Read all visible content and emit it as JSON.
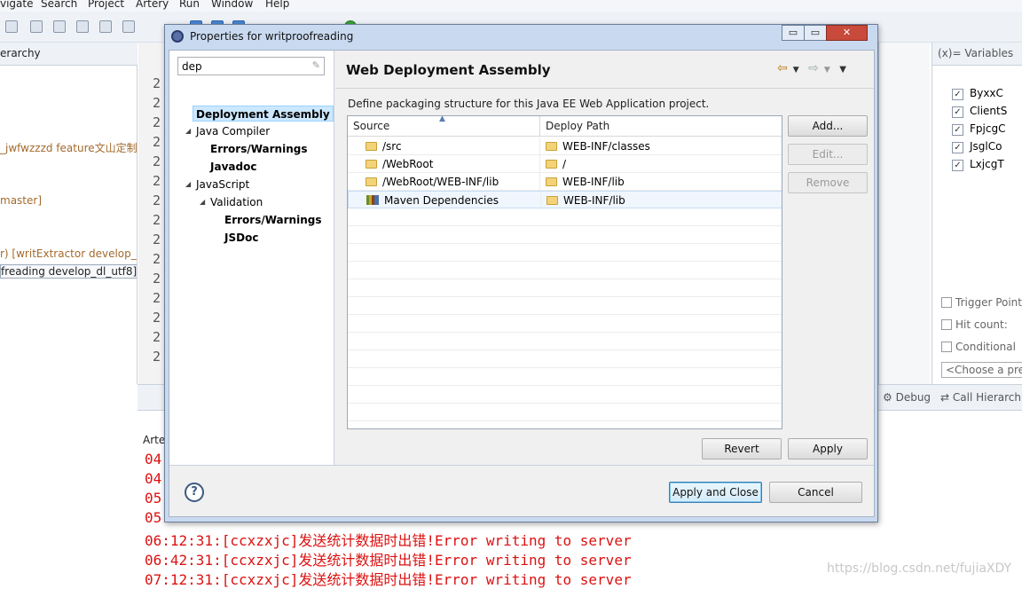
{
  "ide": {
    "menu": [
      "vigate",
      "Search",
      "Project",
      "Artery",
      "Run",
      "Window",
      "Help"
    ],
    "left_panel": {
      "tab_label": "erarchy",
      "lines": [
        "_jwfwzzzd feature文山定制",
        "master]",
        "r) [writExtractor develop_d",
        "freading develop_dl_utf8]"
      ]
    },
    "gutter_numbers": [
      "2",
      "2",
      "2",
      "2",
      "2",
      "2",
      "2",
      "2",
      "2",
      "2",
      "2",
      "2",
      "2",
      "2",
      "2",
      "2"
    ],
    "variables_panel": {
      "tab_label": "(x)= Variables",
      "items": [
        "ByxxC",
        "ClientS",
        "FpjcgC",
        "JsglCo",
        "LxjcgT"
      ]
    },
    "breakpoint_props": {
      "trigger_point": "Trigger Point",
      "hit_count": "Hit count:",
      "conditional": "Conditional",
      "choose": "<Choose a pre"
    },
    "bottom_tabs": {
      "debug": "Debug",
      "call_hierarchy": "Call Hierarch"
    },
    "console": {
      "header": "Arte",
      "lines": [
        "04",
        "04",
        "05",
        "05",
        "06:12:31:[ccxzxjc]发送统计数据时出错!Error writing to server",
        "06:42:31:[ccxzxjc]发送统计数据时出错!Error writing to server",
        "07:12:31:[ccxzxjc]发送统计数据时出错!Error writing to server"
      ]
    },
    "watermark": "https://blog.csdn.net/fujiaXDY"
  },
  "dialog": {
    "title": "Properties for writproofreading",
    "window_buttons": {
      "minimize": "▭",
      "restore": "▭",
      "close": "✕"
    },
    "filter_value": "dep",
    "tree": [
      {
        "label": "Deployment Assembly",
        "selected": true
      },
      {
        "label": "Java Compiler"
      },
      {
        "label": "Errors/Warnings"
      },
      {
        "label": "Javadoc"
      },
      {
        "label": "JavaScript"
      },
      {
        "label": "Validation"
      },
      {
        "label": "Errors/Warnings"
      },
      {
        "label": "JSDoc"
      }
    ],
    "page": {
      "title": "Web Deployment Assembly",
      "description": "Define packaging structure for this Java EE Web Application project.",
      "columns": {
        "source": "Source",
        "deploy_path": "Deploy Path"
      },
      "rows": [
        {
          "source": "/src",
          "deploy_path": "WEB-INF/classes"
        },
        {
          "source": "/WebRoot",
          "deploy_path": "/"
        },
        {
          "source": "/WebRoot/WEB-INF/lib",
          "deploy_path": "WEB-INF/lib"
        },
        {
          "source": "Maven Dependencies",
          "deploy_path": "WEB-INF/lib"
        }
      ],
      "buttons": {
        "add": "Add...",
        "edit": "Edit...",
        "remove": "Remove",
        "revert": "Revert",
        "apply": "Apply"
      }
    },
    "footer": {
      "help": "?",
      "apply_close": "Apply and Close",
      "cancel": "Cancel"
    }
  }
}
